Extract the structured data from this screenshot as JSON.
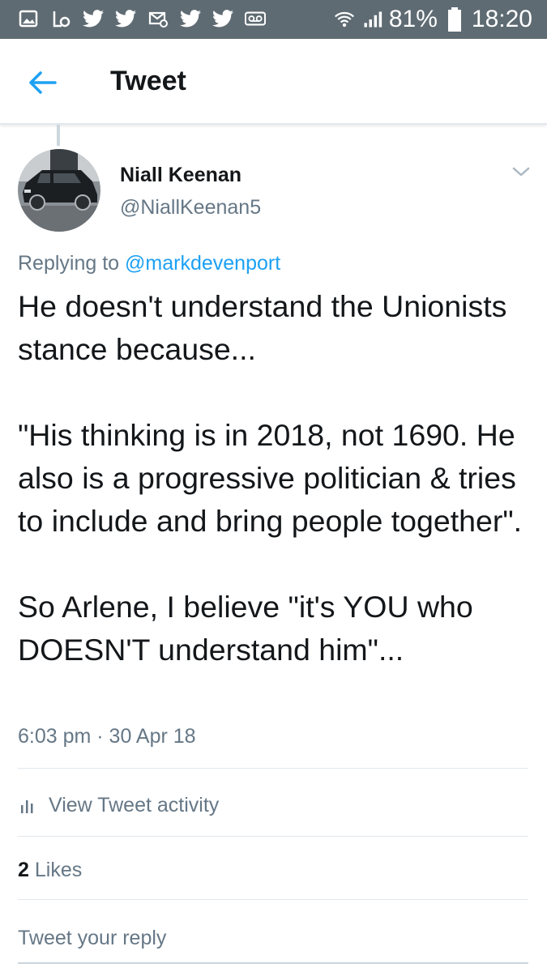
{
  "status_bar": {
    "battery": "81%",
    "time": "18:20",
    "icons": [
      "gallery-icon",
      "missed-call-icon",
      "twitter-icon",
      "twitter-icon",
      "email-icon",
      "twitter-icon",
      "twitter-icon",
      "voicemail-icon",
      "wifi-icon",
      "signal-icon",
      "battery-icon"
    ]
  },
  "header": {
    "title": "Tweet",
    "accent_color": "#1da1f2"
  },
  "tweet": {
    "author_name": "Niall Keenan",
    "author_handle": "@NiallKeenan5",
    "replying_prefix": "Replying to",
    "replying_to": "@markdevenport",
    "text": "He doesn't understand the Unionists stance because...\n\n\"His thinking is in 2018, not 1690. He also is a progressive politician & tries to include and bring people together\".\n\nSo Arlene, I believe \"it's YOU who DOESN'T understand him\"...",
    "timestamp": "6:03 pm · 30 Apr 18"
  },
  "activity": {
    "label": "View Tweet activity"
  },
  "likes": {
    "count": "2",
    "label": "Likes"
  },
  "reply": {
    "placeholder": "Tweet your reply"
  }
}
